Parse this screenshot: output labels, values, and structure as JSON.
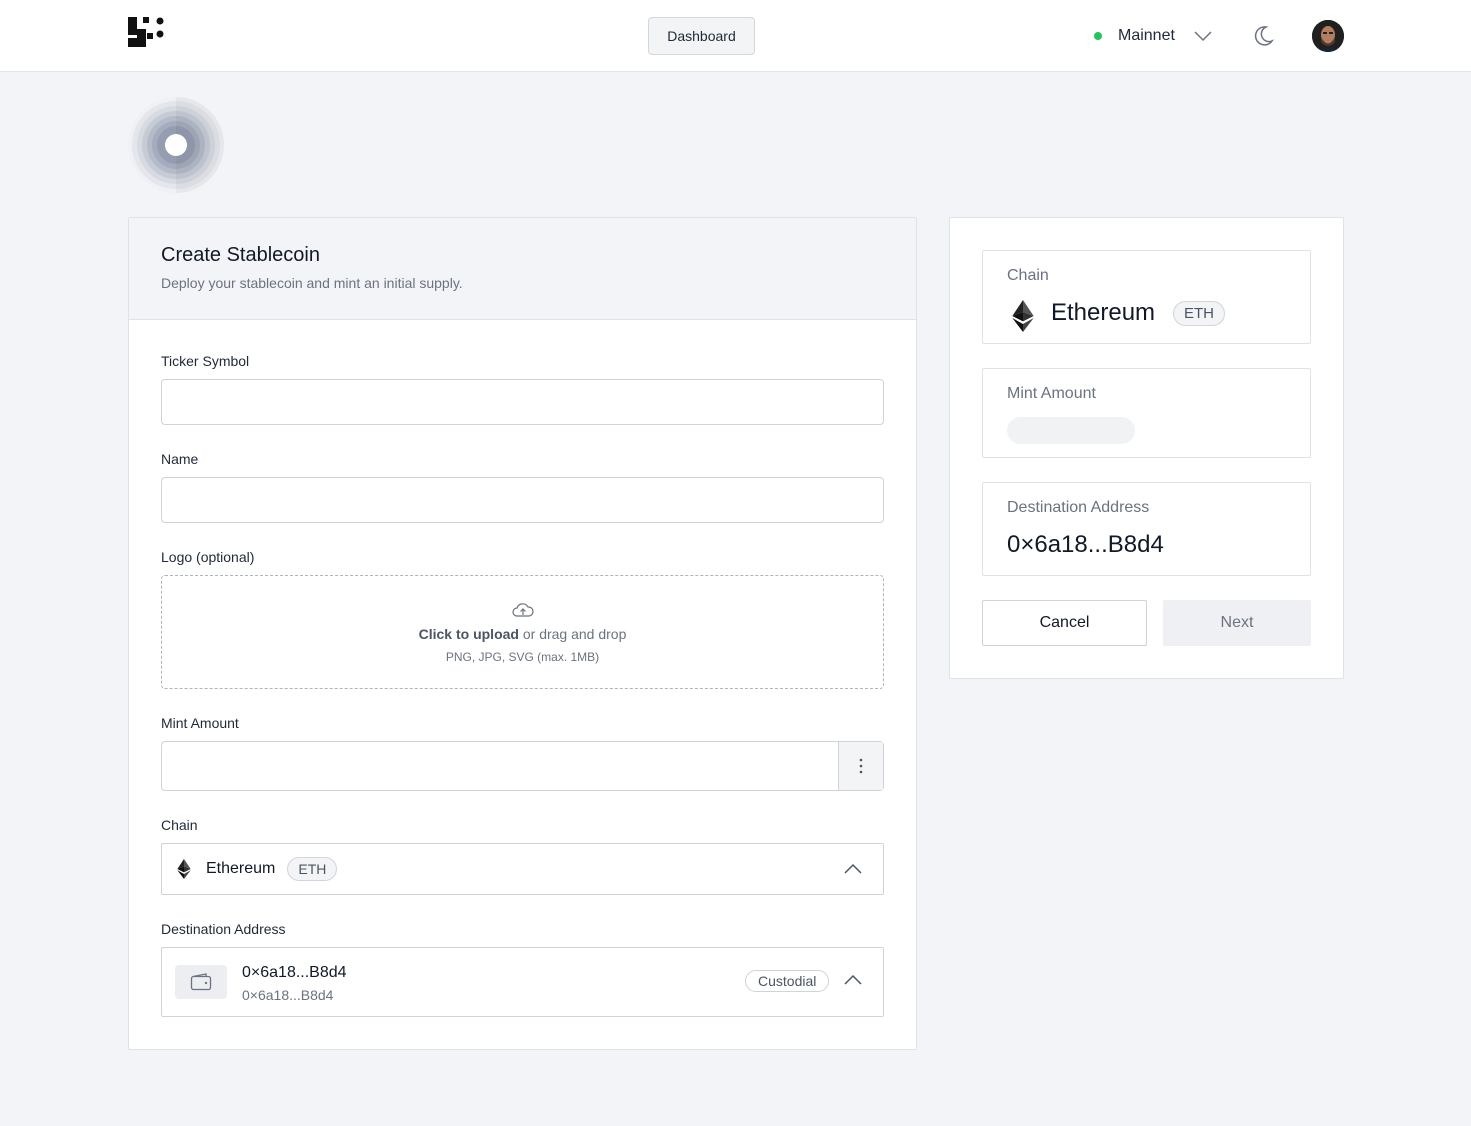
{
  "header": {
    "logo_icon": "pixel-grid-logo",
    "dashboard_label": "Dashboard",
    "network": {
      "label": "Mainnet",
      "status_color": "#22c55e"
    },
    "theme_icon": "moon-icon",
    "avatar_icon": "user-avatar"
  },
  "form": {
    "title": "Create Stablecoin",
    "subtitle": "Deploy your stablecoin and mint an initial supply.",
    "ticker_label": "Ticker Symbol",
    "ticker_value": "",
    "name_label": "Name",
    "name_value": "",
    "logo_label": "Logo (optional)",
    "upload": {
      "click_text": "Click to upload",
      "drag_text": " or drag and drop",
      "hint": "PNG, JPG, SVG (max. 1MB)"
    },
    "mint_label": "Mint Amount",
    "mint_value": "",
    "chain_label": "Chain",
    "chain": {
      "name": "Ethereum",
      "symbol": "ETH"
    },
    "dest_label": "Destination Address",
    "dest": {
      "address": "0×6a18...B8d4",
      "sub_address": "0×6a18...B8d4",
      "tag": "Custodial"
    }
  },
  "summary": {
    "chain_label": "Chain",
    "chain_name": "Ethereum",
    "chain_symbol": "ETH",
    "mint_label": "Mint Amount",
    "dest_label": "Destination Address",
    "dest_address": "0×6a18...B8d4",
    "cancel_label": "Cancel",
    "next_label": "Next"
  },
  "colors": {
    "background": "#f3f4f7",
    "accent_green": "#22c55e",
    "text_primary": "#111827",
    "text_muted": "#6b7280"
  }
}
